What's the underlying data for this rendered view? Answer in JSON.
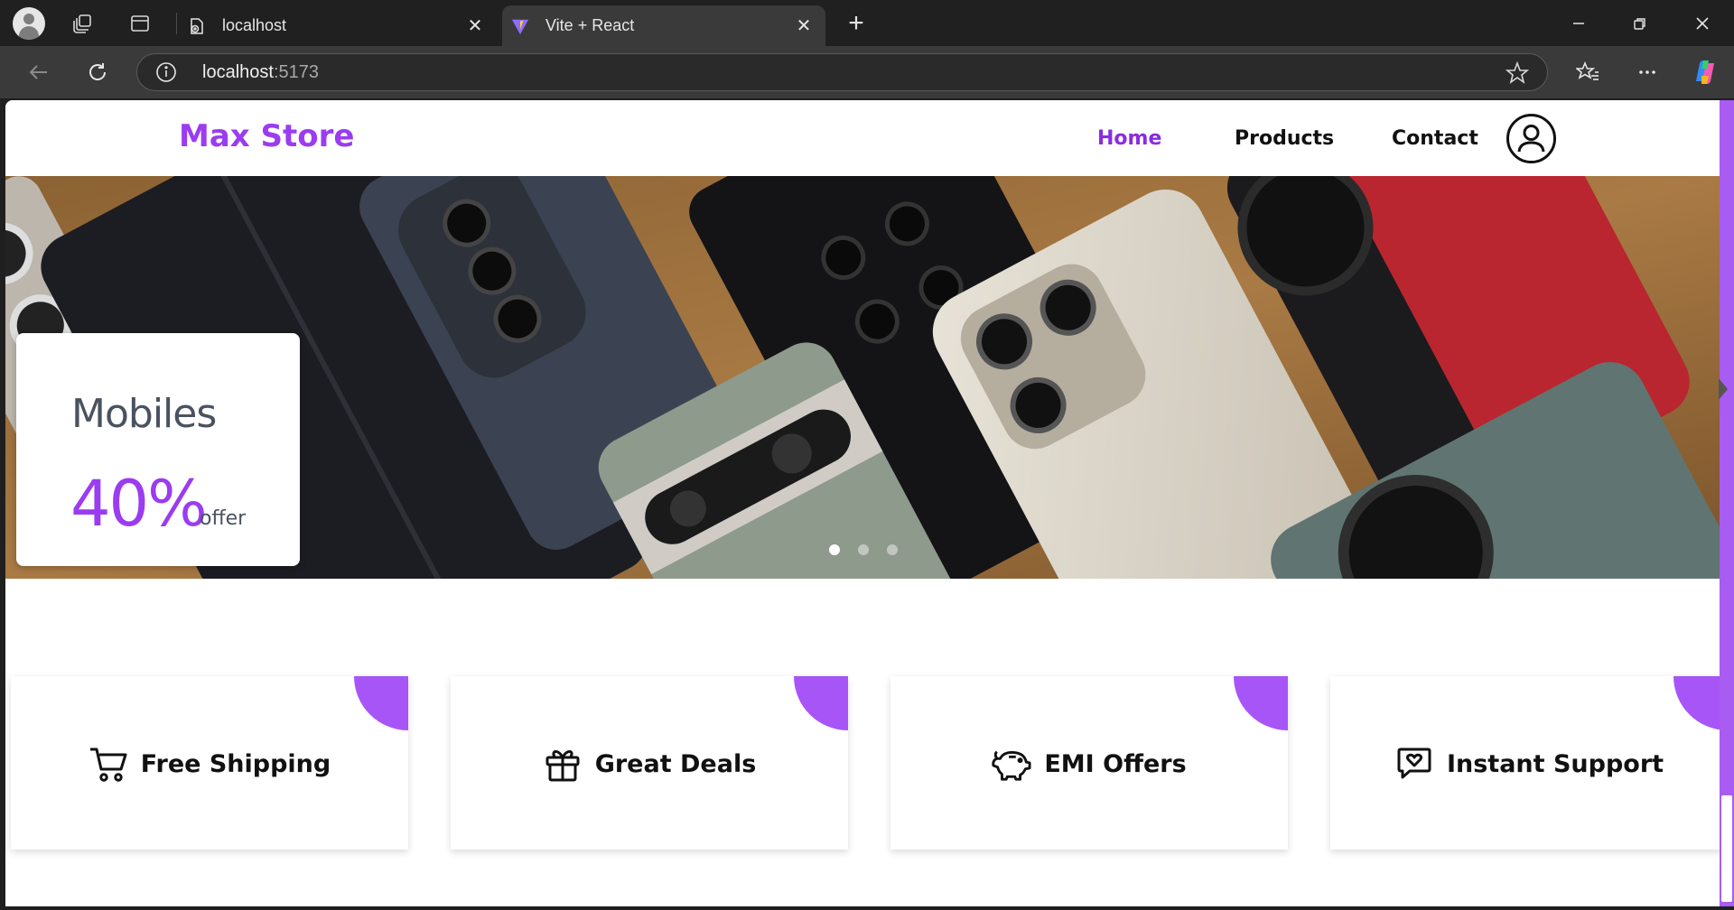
{
  "browser": {
    "tabs": [
      {
        "title": "localhost",
        "active": false
      },
      {
        "title": "Vite + React",
        "active": true
      }
    ],
    "address": {
      "host": "localhost",
      "port": ":5173"
    }
  },
  "site": {
    "brand": "Max Store",
    "nav": {
      "home": "Home",
      "products": "Products",
      "contact": "Contact"
    },
    "hero": {
      "category": "Mobiles",
      "discount": "40%",
      "discount_suffix": "offer",
      "slides_total": 3,
      "active_slide": 1
    },
    "features": [
      {
        "label": "Free Shipping",
        "icon": "cart-icon"
      },
      {
        "label": "Great Deals",
        "icon": "gift-icon"
      },
      {
        "label": "EMI Offers",
        "icon": "piggy-bank-icon"
      },
      {
        "label": "Instant Support",
        "icon": "chat-heart-icon"
      }
    ]
  },
  "colors": {
    "brand": "#9b3cf0",
    "accent_corner": "#a855f7",
    "chrome_dark": "#202020"
  }
}
